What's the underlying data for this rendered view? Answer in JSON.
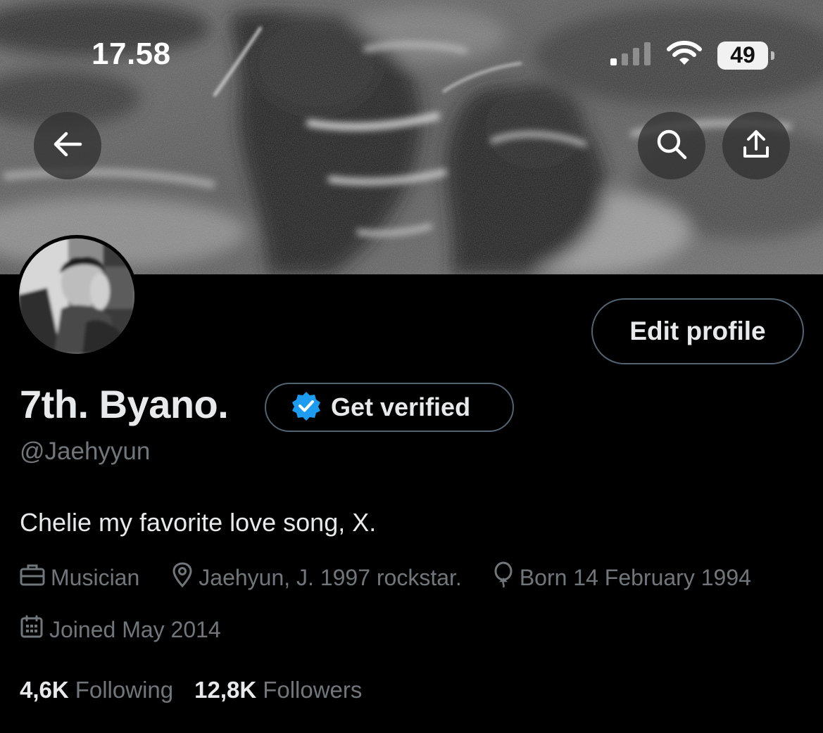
{
  "status_bar": {
    "time": "17.58",
    "battery": "49"
  },
  "header": {
    "back_icon": "arrow-left-icon",
    "search_icon": "search-icon",
    "share_icon": "share-upload-icon"
  },
  "profile": {
    "display_name": "7th. Byano.",
    "handle": "@Jaehyyun",
    "bio": "Chelie my favorite love song, X.",
    "edit_button_label": "Edit profile",
    "get_verified_label": "Get verified",
    "verified_badge_color": "#1d9bf0",
    "profession": "Musician",
    "location": "Jaehyun, J. 1997 rockstar.",
    "birthday": "Born 14 February 1994",
    "joined": "Joined May 2014",
    "following_count": "4,6K",
    "following_label": "Following",
    "followers_count": "12,8K",
    "followers_label": "Followers"
  },
  "colors": {
    "background": "#000000",
    "primary_text": "#e7e9ea",
    "secondary_text": "#71767b",
    "border": "#536471"
  }
}
